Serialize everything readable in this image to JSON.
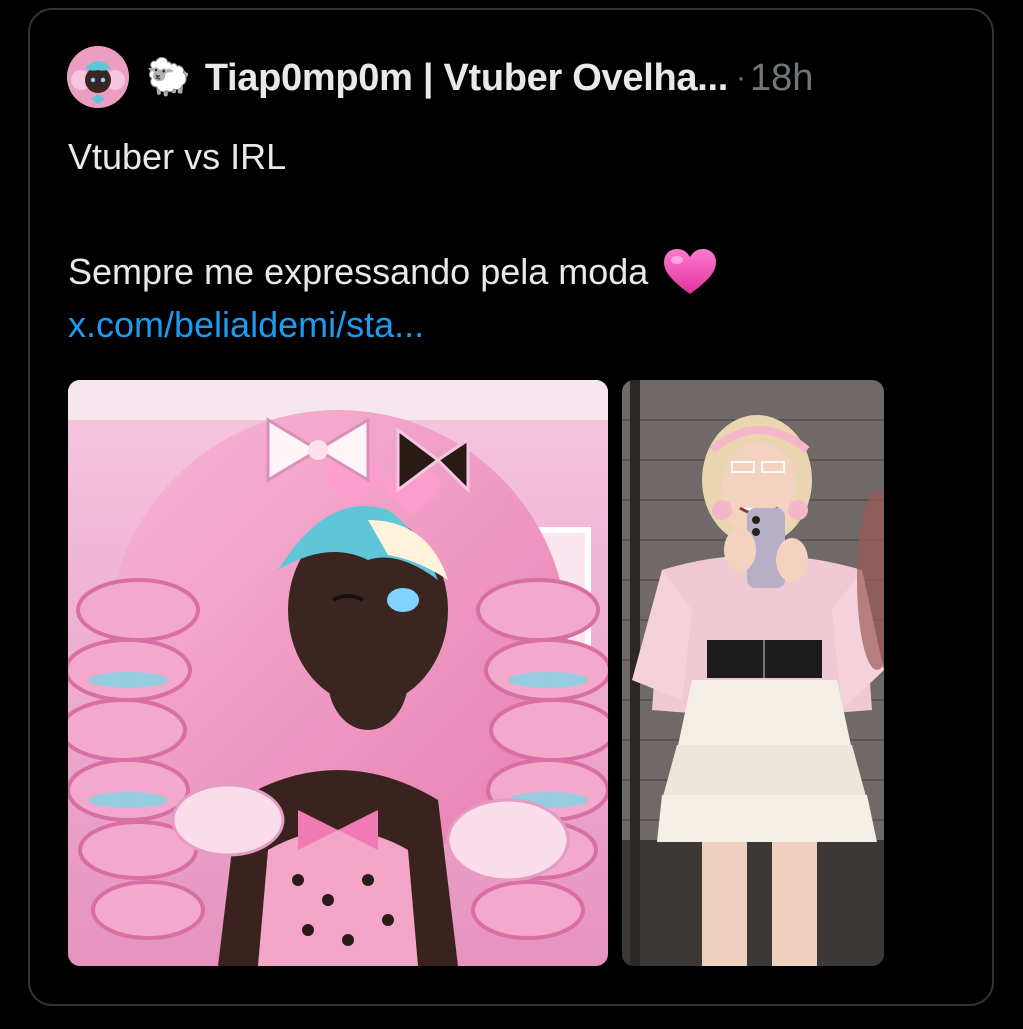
{
  "post": {
    "avatar_icon": "avatar-image",
    "sheep_emoji": "🐑",
    "display_name": "Tiap0mp0m | Vtuber Ovelha...",
    "separator": "·",
    "timestamp": "18h",
    "text_line1": "Vtuber vs IRL",
    "text_line2": "Sempre me expressando pela moda",
    "heart_icon": "pink-heart-icon",
    "link_text": "x.com/belialdemi/sta..."
  },
  "media": [
    {
      "kind": "illustration",
      "subject": "vtuber-avatar"
    },
    {
      "kind": "photo",
      "subject": "mirror-selfie"
    }
  ],
  "colors": {
    "background": "#000000",
    "border": "#2f3336",
    "text": "#e7e9ea",
    "muted": "#71767b",
    "link": "#1d9bf0",
    "heart": "#f24fb5"
  }
}
